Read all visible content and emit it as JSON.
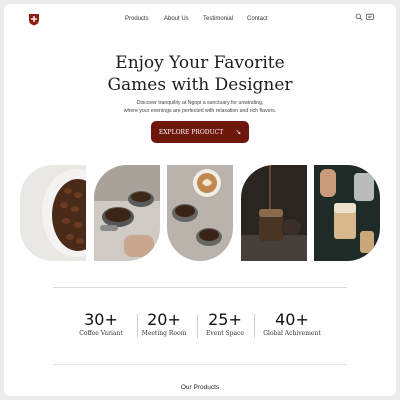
{
  "nav": {
    "items": [
      "Products",
      "About Us",
      "Testimonial",
      "Contact"
    ]
  },
  "hero": {
    "title_line1": "Enjoy Your Favorite",
    "title_line2": "Games with Designer",
    "subtitle_line1": "Discover tranquility at Ngopi a sanctuary for unwinding,",
    "subtitle_line2": "where your evenings are perfected with relaxation and rich flavors.",
    "cta_label": "EXPLORE PRODUCT",
    "cta_icon": "arrow-down-right-icon"
  },
  "gallery": {
    "images": [
      "coffee-beans-bowl",
      "espresso-portafilter-tamping",
      "latte-art-and-ground-coffee",
      "espresso-pour-over-glass",
      "iced-coffee-pour"
    ]
  },
  "stats": [
    {
      "value": "30+",
      "label": "Coffee Variant"
    },
    {
      "value": "20+",
      "label": "Meeting Room"
    },
    {
      "value": "25+",
      "label": "Event Space"
    },
    {
      "value": "40+",
      "label": "Global Achivement"
    }
  ],
  "products_heading": "Our Products",
  "colors": {
    "brand": "#6e170d",
    "background": "#ffffff",
    "text": "#1d1d1d"
  }
}
